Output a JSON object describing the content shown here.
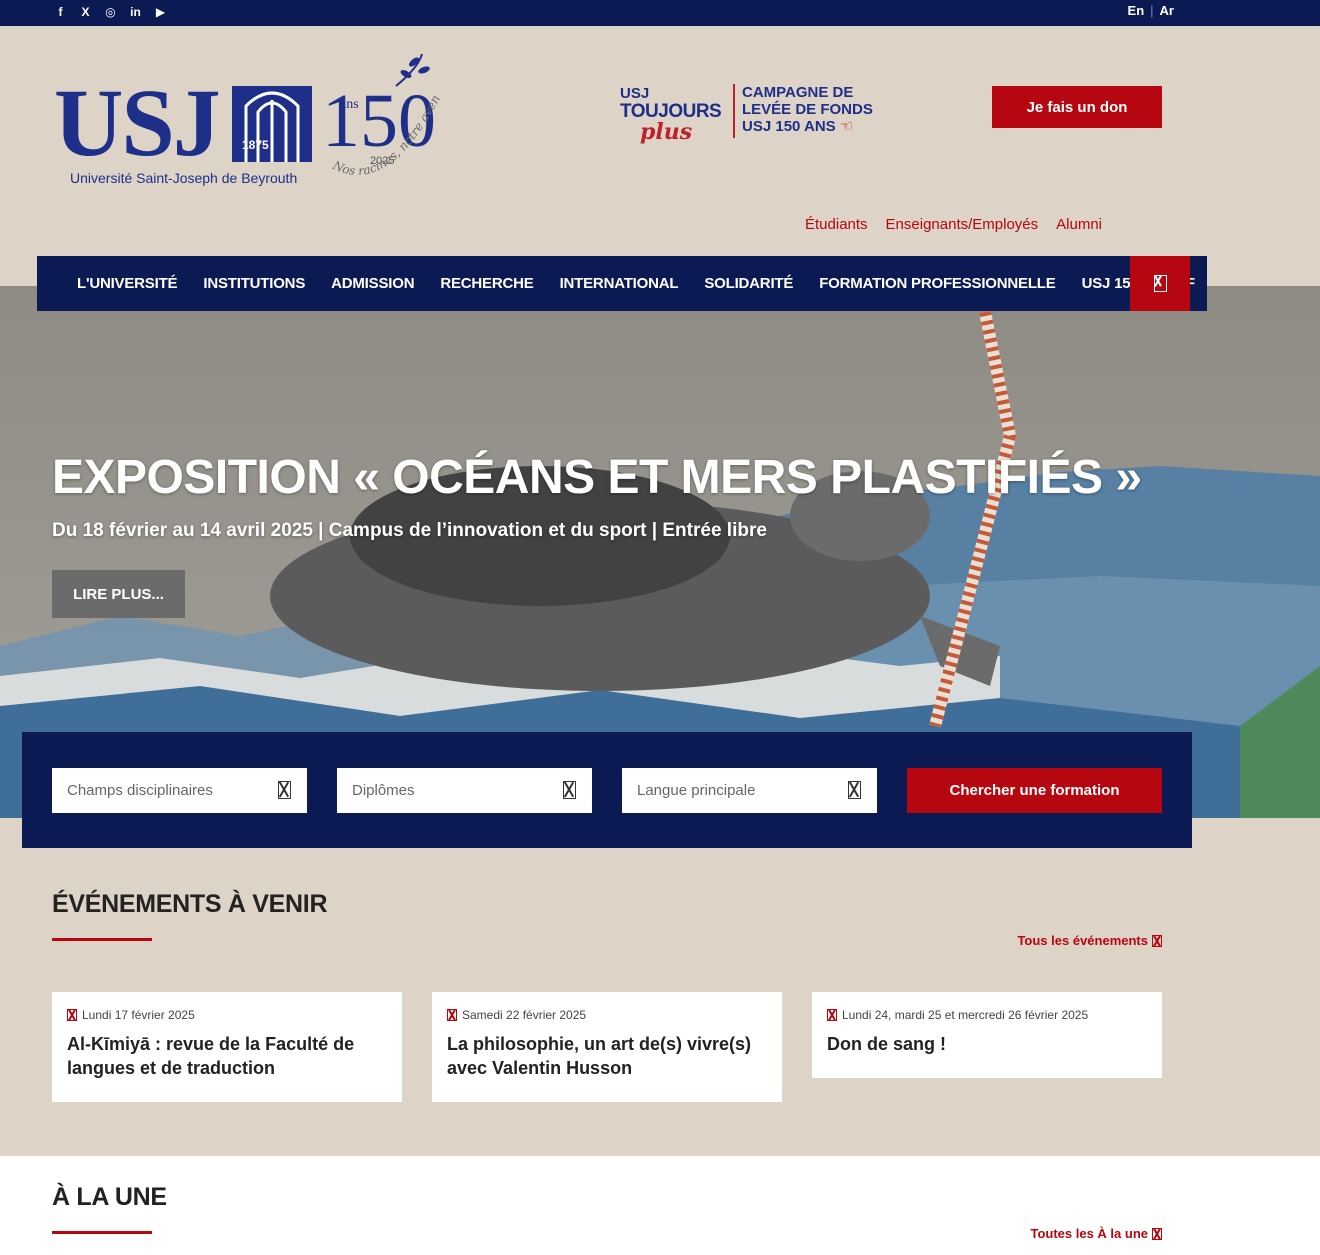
{
  "topbar": {
    "social": [
      {
        "icon": "facebook-icon",
        "glyph": "f"
      },
      {
        "icon": "x-icon",
        "glyph": "X"
      },
      {
        "icon": "instagram-icon",
        "glyph": "◎"
      },
      {
        "icon": "linkedin-icon",
        "glyph": "in"
      },
      {
        "icon": "youtube-icon",
        "glyph": "▶"
      }
    ],
    "lang_en": "En",
    "lang_sep": "|",
    "lang_ar": "Ar"
  },
  "header": {
    "logo_text": "USJ",
    "logo_year": "1875",
    "logo_subtitle": "Université Saint-Joseph de Beyrouth",
    "anniv_number": "150",
    "anniv_ans": "ans",
    "anniv_year": "2025",
    "anniv_motto": "Nos racines, notre avenir",
    "campaign_usj": "USJ",
    "campaign_toujours": "TOUJOURS",
    "campaign_plus": "plus",
    "campaign_line1": "CAMPAGNE DE",
    "campaign_line2": "LEVÉE DE FONDS",
    "campaign_line3": "USJ 150 ANS",
    "donate_label": "Je fais un don",
    "quick_links": [
      "Étudiants",
      "Enseignants/Employés",
      "Alumni"
    ]
  },
  "nav": {
    "items": [
      "L'UNIVERSITÉ",
      "INSTITUTIONS",
      "ADMISSION",
      "RECHERCHE",
      "INTERNATIONAL",
      "SOLIDARITÉ",
      "FORMATION PROFESSIONNELLE",
      "USJ 150",
      "HDF"
    ]
  },
  "hero": {
    "title": "EXPOSITION « OCÉANS ET MERS PLASTIFIÉS »",
    "subtitle": "Du 18 février au 14 avril 2025 | Campus de l’innovation et du sport | Entrée libre",
    "button": "LIRE PLUS..."
  },
  "formation_search": {
    "field1": "Champs disciplinaires",
    "field2": "Diplômes",
    "field3": "Langue principale",
    "button": "Chercher une formation"
  },
  "events": {
    "heading": "ÉVÉNEMENTS À VENIR",
    "all_link": "Tous les événements",
    "items": [
      {
        "date": "Lundi 17 février 2025",
        "title": "Al-Kīmiyā : revue de la Faculté de langues et de traduction"
      },
      {
        "date": "Samedi 22 février 2025",
        "title": "La philosophie, un art de(s) vivre(s) avec Valentin Husson"
      },
      {
        "date": "Lundi 24, mardi 25 et mercredi 26 février 2025",
        "title": "Don de sang !"
      }
    ]
  },
  "une": {
    "heading": "À LA UNE",
    "all_link": "Toutes les À la une"
  },
  "colors": {
    "navy": "#0c1a54",
    "brand_red": "#b60610",
    "beige": "#ddd3c6",
    "logo_blue": "#1e2f8a"
  }
}
